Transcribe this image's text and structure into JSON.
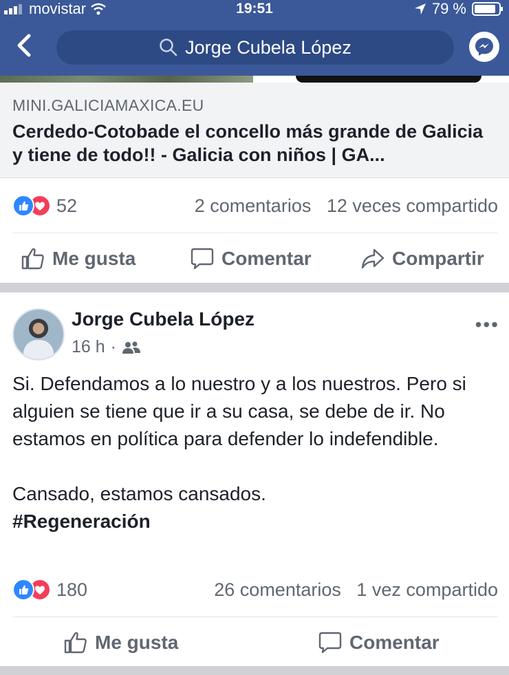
{
  "status_bar": {
    "carrier": "movistar",
    "time": "19:51",
    "battery": "79 %"
  },
  "nav": {
    "search_text": "Jorge Cubela López",
    "icons": [
      "back-chevron-icon",
      "search-icon",
      "messenger-icon"
    ]
  },
  "shared_link": {
    "domain": "MINI.GALICIAMAXICA.EU",
    "title": "Cerdedo-Cotobade el concello más grande de Galicia y tiene de todo!! - Galicia con niños | GA..."
  },
  "post1_stats": {
    "reactions": "52",
    "comments": "2 comentarios",
    "shares": "12 veces compartido"
  },
  "post1_actions": {
    "like": "Me gusta",
    "comment": "Comentar",
    "share": "Compartir"
  },
  "post2": {
    "author": "Jorge Cubela López",
    "time": "16 h",
    "more": "•••",
    "paragraph1": "Si. Defendamos a lo nuestro y a los nuestros. Pero si alguien se tiene que ir a su casa, se debe de ir. No estamos en política para defender lo indefendible.",
    "paragraph2": "Cansado, estamos cansados.",
    "hashtag": "#Regeneración",
    "reactions": "180",
    "comments": "26 comentarios",
    "shares": "1 vez compartido",
    "like": "Me gusta",
    "comment": "Comentar"
  },
  "colors": {
    "header_blue": "#3b5998",
    "like_blue": "#2d88ff",
    "love_red": "#f33e58",
    "secondary_text": "#606770"
  }
}
